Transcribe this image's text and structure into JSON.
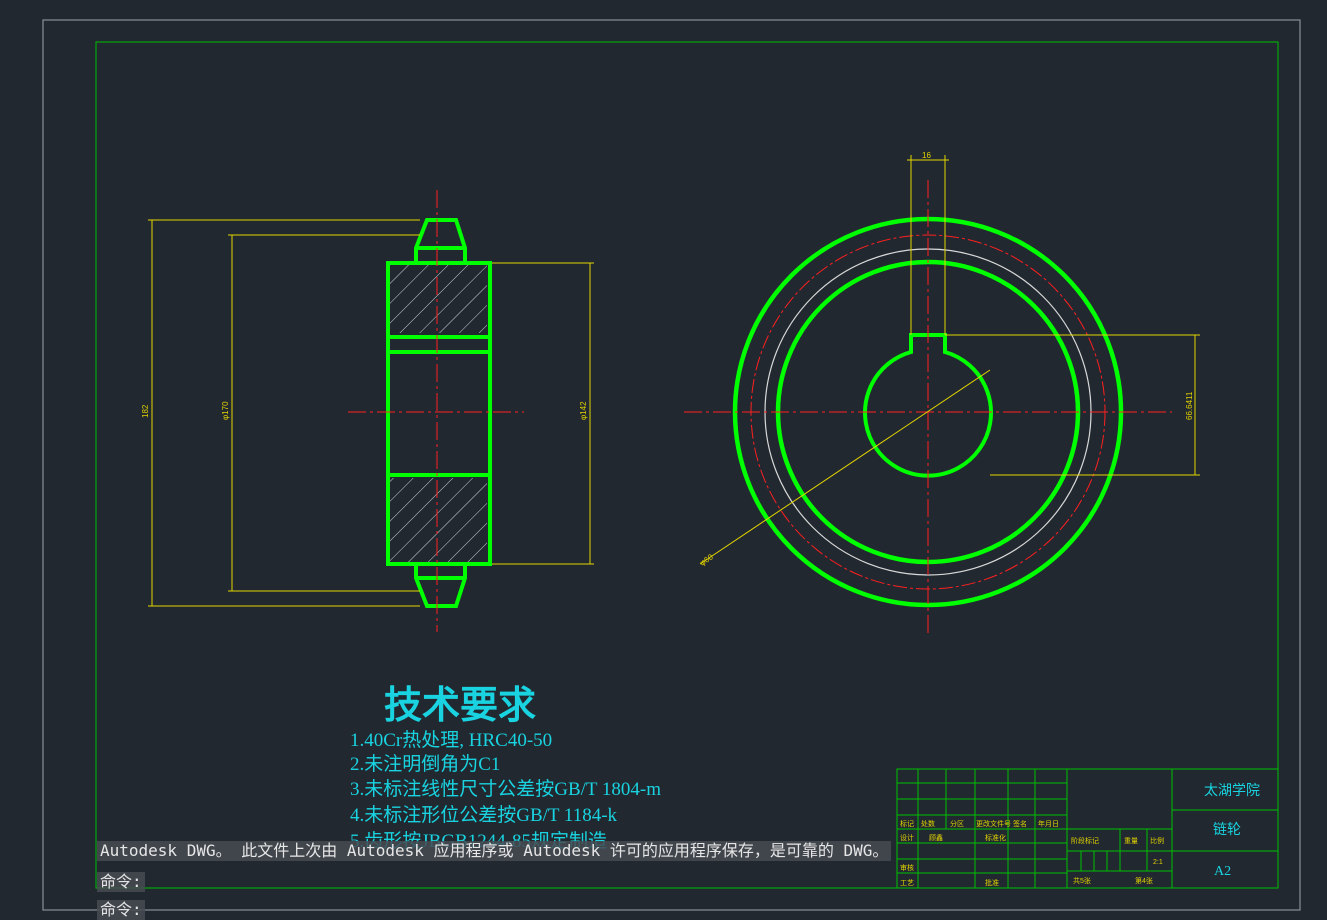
{
  "drawing": {
    "tech_req": {
      "title": "技术要求",
      "lines": [
        "1.40Cr热处理, HRC40-50",
        "2.未注明倒角为C1",
        "3.未标注线性尺寸公差按GB/T 1804-m",
        "4.未标注形位公差按GB/T 1184-k",
        "5.齿形按JBGB1244-85规定制造"
      ]
    },
    "dimensions": {
      "outer": "182",
      "root": "φ170",
      "hub": "φ142",
      "keyway_width": "16",
      "keyway_depth": "66.6411",
      "bore": "φ60"
    },
    "title_block": {
      "school": "太湖学院",
      "part_name": "链轮",
      "sheet_size": "A2",
      "scale": "2:1",
      "header_labels": [
        "标记",
        "处数",
        "分区",
        "更改文件号",
        "签名",
        "年月日"
      ],
      "row_labels": [
        "设计",
        "标准化",
        "审核",
        "工艺",
        "批准"
      ],
      "signature": "顾鑫",
      "stage_labels": [
        "阶段标记",
        "重量",
        "比例"
      ],
      "sheet_total": "共5张",
      "sheet_no": "第4张"
    },
    "colors": {
      "background": "#212830",
      "outline": "#00ff00",
      "center_line": "#ff2020",
      "dimension": "#e3d400",
      "text": "#19d3e0",
      "frame": "#8a8f96"
    }
  },
  "command": {
    "message": "Autodesk DWG。 此文件上次由 Autodesk 应用程序或 Autodesk 许可的应用程序保存，是可靠的 DWG。",
    "prompt_1": "命令:",
    "prompt_2": "命令:"
  }
}
